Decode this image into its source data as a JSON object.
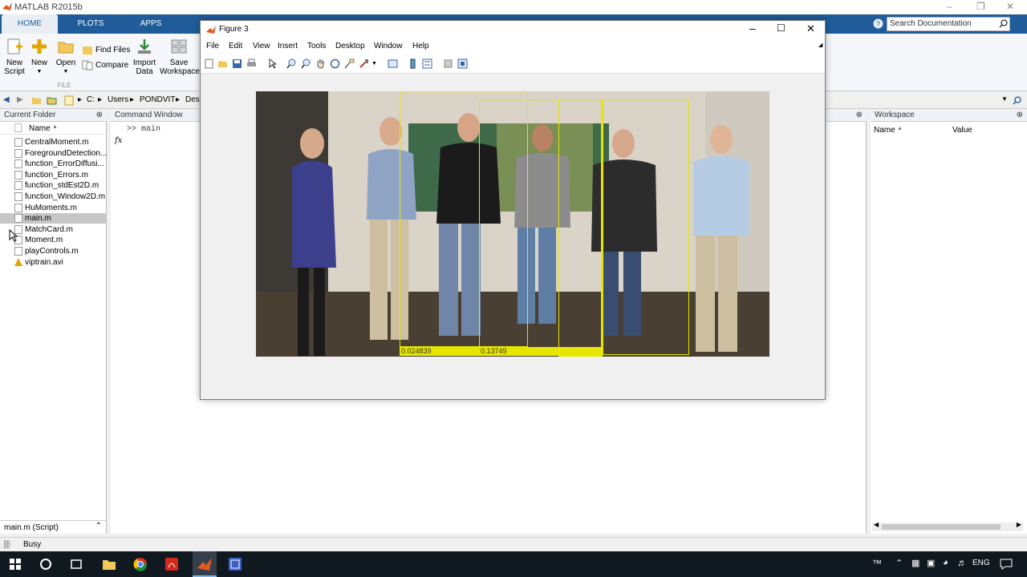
{
  "app": {
    "title": "MATLAB R2015b"
  },
  "ribbon_tabs": [
    "HOME",
    "PLOTS",
    "APPS"
  ],
  "search": {
    "placeholder": "Search Documentation"
  },
  "ribbon": {
    "new_script": "New\nScript",
    "new": "New",
    "open": "Open",
    "find_files": "Find Files",
    "compare": "Compare",
    "import_data": "Import\nData",
    "save_workspace": "Save\nWorkspace",
    "group_file": "FILE"
  },
  "path": [
    "C:",
    "Users",
    "PONDVIT",
    "Desk"
  ],
  "current_folder": {
    "title": "Current Folder",
    "column": "Name",
    "files": [
      {
        "name": "CentralMoment.m",
        "type": "m"
      },
      {
        "name": "ForegroundDetection...",
        "type": "m"
      },
      {
        "name": "function_ErrorDiffusi...",
        "type": "m"
      },
      {
        "name": "function_Errors.m",
        "type": "m"
      },
      {
        "name": "function_stdEst2D.m",
        "type": "m"
      },
      {
        "name": "function_Window2D.m",
        "type": "m"
      },
      {
        "name": "HuMoments.m",
        "type": "m"
      },
      {
        "name": "main.m",
        "type": "m",
        "selected": true
      },
      {
        "name": "MatchCard.m",
        "type": "m"
      },
      {
        "name": "Moment.m",
        "type": "m"
      },
      {
        "name": "playControls.m",
        "type": "m"
      },
      {
        "name": "viptrain.avi",
        "type": "avi"
      }
    ],
    "details": "main.m  (Script)"
  },
  "command_window": {
    "title": "Command Window",
    "prompt": ">>",
    "command": "main",
    "fx": "fx"
  },
  "workspace": {
    "title": "Workspace",
    "col_name": "Name",
    "col_value": "Value"
  },
  "status": {
    "text": "Busy"
  },
  "figure": {
    "title": "Figure 3",
    "menus": [
      "File",
      "Edit",
      "View",
      "Insert",
      "Tools",
      "Desktop",
      "Window",
      "Help"
    ],
    "detections": [
      {
        "score_label": "0.024839"
      },
      {
        "score_label": "0.13749"
      },
      {
        "score_label": ""
      },
      {
        "score_label": ""
      }
    ]
  },
  "taskbar": {
    "lang": "ENG"
  },
  "colors": {
    "accent": "#1f5c99",
    "bbox": "#e6e600",
    "taskbar": "#101820"
  }
}
